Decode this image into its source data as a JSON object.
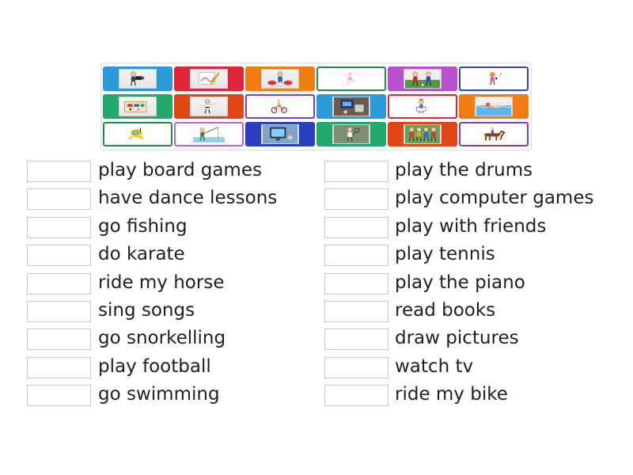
{
  "tiles": [
    {
      "icon": "photographer-picture-icon",
      "style": "filled",
      "color": "#2a9bd8"
    },
    {
      "icon": "drawing-pencil-picture-icon",
      "style": "filled",
      "color": "#e0243a"
    },
    {
      "icon": "drummer-picture-icon",
      "style": "filled",
      "color": "#f07c12"
    },
    {
      "icon": "ballet-dancer-picture-icon",
      "style": "outlined",
      "color": "#1b8f4a"
    },
    {
      "icon": "football-players-picture-icon",
      "style": "filled",
      "color": "#b84fd0"
    },
    {
      "icon": "singing-girl-picture-icon",
      "style": "outlined",
      "color": "#3346b8"
    },
    {
      "icon": "board-game-picture-icon",
      "style": "filled",
      "color": "#22a86a"
    },
    {
      "icon": "karate-kid-picture-icon",
      "style": "filled",
      "color": "#e04514"
    },
    {
      "icon": "bike-rider-picture-icon",
      "style": "outlined",
      "color": "#7a3fbf"
    },
    {
      "icon": "computer-games-picture-icon",
      "style": "filled",
      "color": "#2a9bd8"
    },
    {
      "icon": "reading-boy-picture-icon",
      "style": "outlined",
      "color": "#e0243a"
    },
    {
      "icon": "swimmer-picture-icon",
      "style": "filled",
      "color": "#f07c12"
    },
    {
      "icon": "snorkeller-picture-icon",
      "style": "outlined",
      "color": "#1b8f4a"
    },
    {
      "icon": "fishing-picture-icon",
      "style": "outlined",
      "color": "#c560d8"
    },
    {
      "icon": "watching-tv-picture-icon",
      "style": "filled",
      "color": "#2a3fbf"
    },
    {
      "icon": "tennis-player-picture-icon",
      "style": "filled",
      "color": "#22a86a"
    },
    {
      "icon": "kids-playing-picture-icon",
      "style": "filled",
      "color": "#e04514"
    },
    {
      "icon": "horse-rider-picture-icon",
      "style": "outlined",
      "color": "#7a3fbf"
    }
  ],
  "left_items": [
    {
      "label": "play board games"
    },
    {
      "label": "have dance lessons"
    },
    {
      "label": "go fishing"
    },
    {
      "label": "do karate"
    },
    {
      "label": "ride my horse"
    },
    {
      "label": "sing songs"
    },
    {
      "label": "go snorkelling"
    },
    {
      "label": "play football"
    },
    {
      "label": "go swimming"
    }
  ],
  "right_items": [
    {
      "label": "play the drums"
    },
    {
      "label": "play computer games"
    },
    {
      "label": "play with friends"
    },
    {
      "label": "play tennis"
    },
    {
      "label": "play the piano"
    },
    {
      "label": "read books"
    },
    {
      "label": "draw pictures"
    },
    {
      "label": "watch tv"
    },
    {
      "label": "ride my bike"
    }
  ]
}
